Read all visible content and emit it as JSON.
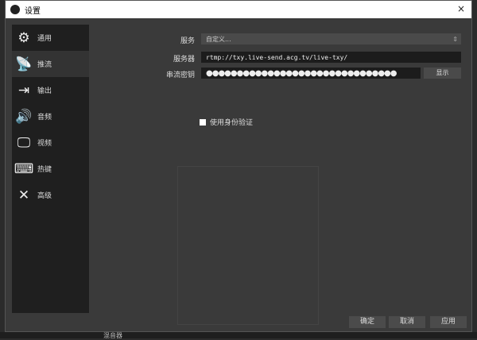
{
  "window": {
    "title": "设置",
    "close_icon": "×"
  },
  "sidebar": {
    "items": [
      {
        "label": "通用",
        "icon": "gear-icon",
        "glyph": "⚙"
      },
      {
        "label": "推流",
        "icon": "antenna-icon",
        "glyph": "📡",
        "active": true
      },
      {
        "label": "输出",
        "icon": "output-icon",
        "glyph": "⇥"
      },
      {
        "label": "音频",
        "icon": "speaker-icon",
        "glyph": "🔊"
      },
      {
        "label": "视频",
        "icon": "monitor-icon",
        "glyph": "🖵"
      },
      {
        "label": "热键",
        "icon": "keyboard-icon",
        "glyph": "⌨"
      },
      {
        "label": "高级",
        "icon": "tools-icon",
        "glyph": "✕"
      }
    ]
  },
  "form": {
    "service_label": "服务",
    "service_value": "自定义...",
    "server_label": "服务器",
    "server_value": "rtmp://txy.live-send.acg.tv/live-txy/",
    "key_label": "串流密钥",
    "key_value": "●●●●●●●●●●●●●●●●●●●●●●●●●●●●●●●",
    "show_button": "显示",
    "auth_label": "使用身份验证",
    "auth_checked": false
  },
  "footer": {
    "ok": "确定",
    "cancel": "取消",
    "apply": "应用"
  },
  "background": {
    "text": "混音器"
  }
}
